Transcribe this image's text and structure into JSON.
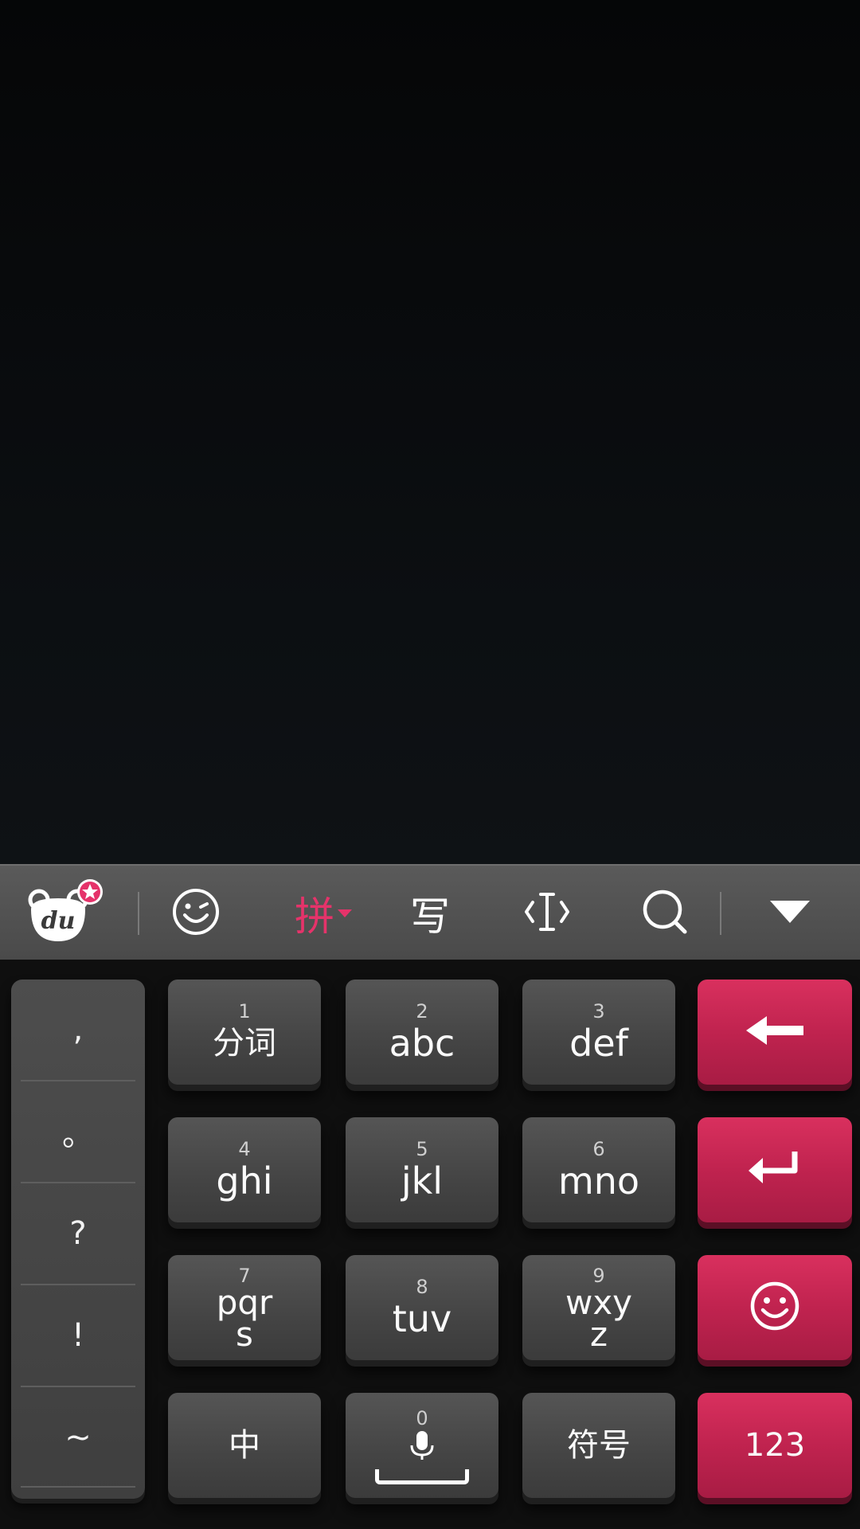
{
  "toolbar": {
    "logo_text": "du",
    "pinyin_label": "拼",
    "handwrite_label": "写",
    "icons": {
      "logo": "du-bear-logo-icon",
      "emoji": "smiley-wink-icon",
      "handwrite": "handwrite-icon",
      "cursor": "cursor-move-icon",
      "search": "search-icon",
      "hide": "triangle-down-icon"
    },
    "accent_color": "#e5336a"
  },
  "punctuation": [
    ",",
    "。",
    "?",
    "!",
    "~"
  ],
  "keys": {
    "k1": {
      "num": "1",
      "label": "分词"
    },
    "k2": {
      "num": "2",
      "label": "abc"
    },
    "k3": {
      "num": "3",
      "label": "def"
    },
    "k4": {
      "num": "4",
      "label": "ghi"
    },
    "k5": {
      "num": "5",
      "label": "jkl"
    },
    "k6": {
      "num": "6",
      "label": "mno"
    },
    "k7": {
      "num": "7",
      "label_line1": "pqr",
      "label_line2": "s"
    },
    "k8": {
      "num": "8",
      "label": "tuv"
    },
    "k9": {
      "num": "9",
      "label_line1": "wxy",
      "label_line2": "z"
    },
    "zh": {
      "label": "中"
    },
    "space": {
      "num": "0"
    },
    "symbols": {
      "label": "符号"
    },
    "num_switch": {
      "label": "123"
    }
  },
  "colors": {
    "key_red": "#c8254f",
    "key_gray": "#474747",
    "toolbar_bg": "#525252"
  }
}
